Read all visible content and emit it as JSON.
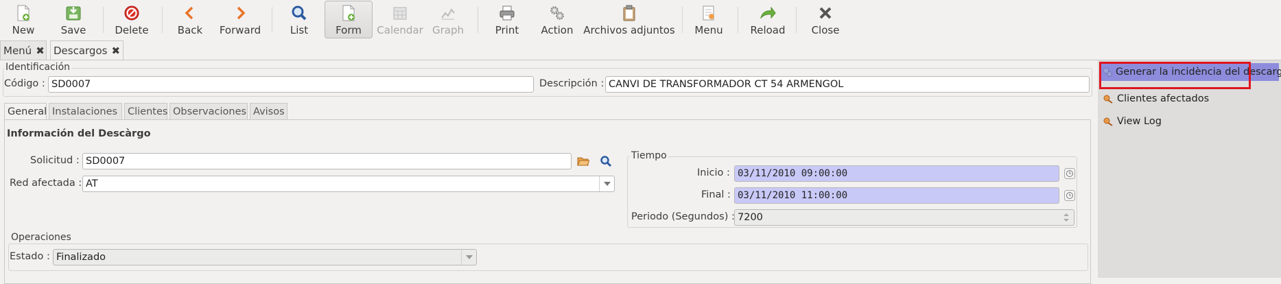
{
  "toolbar": {
    "new": "New",
    "save": "Save",
    "delete": "Delete",
    "back": "Back",
    "forward": "Forward",
    "list": "List",
    "form": "Form",
    "calendar": "Calendar",
    "graph": "Graph",
    "print": "Print",
    "action": "Action",
    "attachments": "Archivos adjuntos",
    "menu": "Menu",
    "reload": "Reload",
    "close": "Close"
  },
  "tabs": {
    "menu": "Menú",
    "descargos": "Descargos"
  },
  "identificacion": {
    "title": "Identificación",
    "codigo_label": "Código :",
    "codigo_value": "SD0007",
    "descripcion_label": "Descripción :",
    "descripcion_value": "CANVI DE TRANSFORMADOR CT 54 ARMENGOL"
  },
  "notebook": {
    "tabs": [
      "General",
      "Instalaciones",
      "Clientes",
      "Observaciones",
      "Avisos"
    ]
  },
  "general": {
    "section_title": "Información del Descàrgo",
    "solicitud_label": "Solicitud :",
    "solicitud_value": "SD0007",
    "red_label": "Red afectada :",
    "red_value": "AT",
    "tiempo_title": "Tiempo",
    "inicio_label": "Inicio :",
    "inicio_value": "03/11/2010 09:00:00",
    "final_label": "Final :",
    "final_value": "03/11/2010 11:00:00",
    "periodo_label": "Periodo (Segundos) :",
    "periodo_value": "7200",
    "operaciones_title": "Operaciones",
    "estado_label": "Estado :",
    "estado_value": "Finalizado"
  },
  "side_panel": {
    "items": [
      "Generar la incidència del descargo",
      "Clientes afectados",
      "View Log"
    ]
  },
  "colors": {
    "selected_side": "#8d8cdc",
    "highlight_border": "#e0141e",
    "date_field_bg": "#c9c9f8"
  }
}
